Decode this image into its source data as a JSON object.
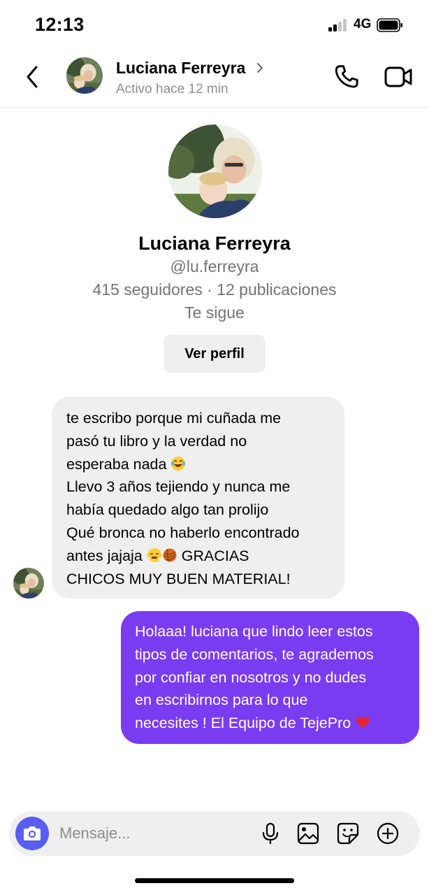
{
  "status_bar": {
    "time": "12:13",
    "network": "4G",
    "icons": [
      "signal-icon",
      "battery-icon"
    ]
  },
  "header": {
    "name": "Luciana Ferreyra",
    "status": "Activo hace 12 min",
    "icons": [
      "back-chevron-icon",
      "chevron-right-icon",
      "phone-icon",
      "video-camera-icon"
    ]
  },
  "profile": {
    "name": "Luciana Ferreyra",
    "handle": "@lu.ferreyra",
    "stats": "415 seguidores · 12 publicaciones",
    "follows_you": "Te sigue",
    "view_profile_label": "Ver perfil"
  },
  "messages": [
    {
      "direction": "incoming",
      "lines": [
        "te escribo porque mi cuñada me",
        "pasó tu libro y la verdad no",
        "esperaba nada",
        "Llevo 3 años tejiendo y nunca me",
        "había quedado algo tan prolijo",
        "Qué bronca no haberlo encontrado",
        "antes jajaja",
        "GRACIAS",
        "CHICOS MUY BUEN MATERIAL!"
      ],
      "emojis": [
        "laughing-tears-emoji",
        "steam-face-emoji",
        "yarn-ball-emoji"
      ]
    },
    {
      "direction": "outgoing",
      "lines": [
        "Holaaa! luciana que lindo leer estos",
        "tipos de comentarios, te agrademos",
        "por confiar en nosotros y no dudes",
        "en escribirnos  para lo que",
        "necesites ! El Equipo de TejePro"
      ],
      "emojis": [
        "red-heart-emoji"
      ]
    }
  ],
  "composer": {
    "placeholder": "Mensaje...",
    "icons": [
      "camera-icon",
      "microphone-icon",
      "gallery-icon",
      "sticker-icon",
      "add-icon"
    ]
  },
  "colors": {
    "outgoing_bubble": "#7a3cf0",
    "incoming_bubble": "#efefef",
    "camera_button": "#5a5ef0",
    "secondary_text": "#737373"
  }
}
